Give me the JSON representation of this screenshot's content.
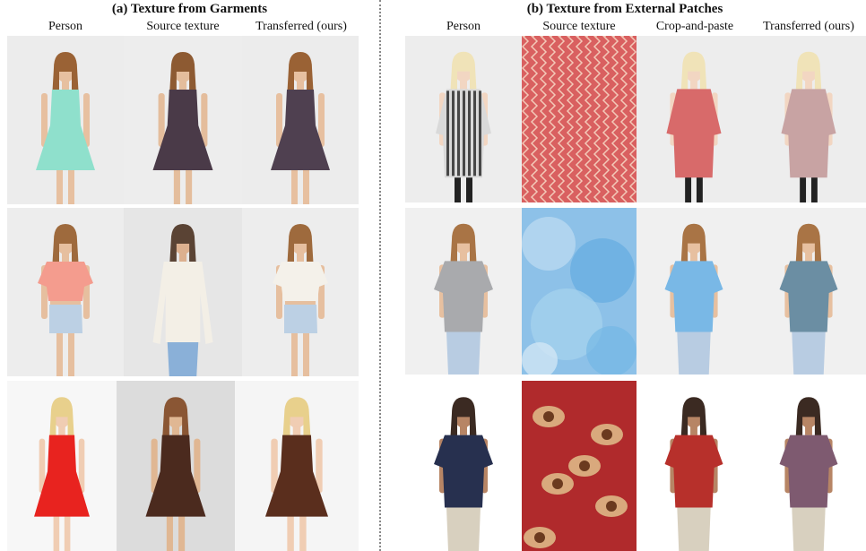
{
  "panel_a": {
    "title": "(a) Texture from Garments",
    "columns": [
      "Person",
      "Source texture",
      "Transferred (ours)"
    ]
  },
  "panel_b": {
    "title": "(b) Texture from External Patches",
    "columns": [
      "Person",
      "Source texture",
      "Crop-and-paste",
      "Transferred (ours)"
    ]
  },
  "tiles": [
    {
      "row": "a1",
      "col": "person",
      "garment": "#8fe0cc",
      "bg": "#ececec",
      "skin": "#e7c0a0",
      "hair": "#9a6235",
      "type": "dress"
    },
    {
      "row": "a1",
      "col": "source",
      "garment": "#4a3a48",
      "bg": "#ededed",
      "skin": "#e4bd9c",
      "hair": "#8d5a32",
      "type": "dress-short"
    },
    {
      "row": "a1",
      "col": "ours",
      "garment": "#4f4050",
      "bg": "#ececec",
      "skin": "#e7c0a0",
      "hair": "#9a6235",
      "type": "dress"
    },
    {
      "row": "a2",
      "col": "person",
      "garment": "#f49c8e",
      "bg": "#ededed",
      "skin": "#e6bf9f",
      "hair": "#9e6a3d",
      "type": "crop",
      "pants": "#bcd0e4"
    },
    {
      "row": "a2",
      "col": "source",
      "garment": "#f3efe6",
      "bg": "#e6e6e6",
      "skin": "#dcb08f",
      "hair": "#5a4334",
      "type": "longsleeve",
      "pants": "#8ab0d8"
    },
    {
      "row": "a2",
      "col": "ours",
      "garment": "#f4f1ea",
      "bg": "#ededed",
      "skin": "#e6bf9f",
      "hair": "#9e6a3d",
      "type": "crop",
      "pants": "#bcd0e4"
    },
    {
      "row": "a3",
      "col": "person",
      "garment": "#e8231f",
      "bg": "#f7f7f7",
      "skin": "#f0cdb3",
      "hair": "#e8d08c",
      "type": "dress"
    },
    {
      "row": "a3",
      "col": "source",
      "garment": "#4b2a1e",
      "bg": "#dcdcdc",
      "skin": "#e0b793",
      "hair": "#8a5634",
      "type": "tank-dress"
    },
    {
      "row": "a3",
      "col": "ours",
      "garment": "#5a2e1d",
      "bg": "#f5f5f5",
      "skin": "#f0cdb3",
      "hair": "#e8d08c",
      "type": "dress"
    },
    {
      "row": "b1",
      "col": "person",
      "garment": "#d9d9d9",
      "bg": "#ededed",
      "skin": "#f2d6c2",
      "hair": "#f0e3b8",
      "type": "shirtdress",
      "stripes": "#222"
    },
    {
      "row": "b1",
      "col": "source",
      "garment": "#d96060",
      "type": "zigzag"
    },
    {
      "row": "b1",
      "col": "crop",
      "garment": "#d86a6a",
      "bg": "#ededed",
      "skin": "#f2d6c2",
      "hair": "#f0e3b8",
      "type": "shirtdress"
    },
    {
      "row": "b1",
      "col": "ours",
      "garment": "#c8a3a3",
      "bg": "#ededed",
      "skin": "#f2d6c2",
      "hair": "#f0e3b8",
      "type": "shirtdress"
    },
    {
      "row": "b2",
      "col": "person",
      "garment": "#a9aaad",
      "bg": "#f0f0f0",
      "skin": "#e7c0a0",
      "hair": "#a97445",
      "type": "tee",
      "pants": "#b8cce2"
    },
    {
      "row": "b2",
      "col": "source",
      "garment": "#8dc1e8",
      "type": "watercolor"
    },
    {
      "row": "b2",
      "col": "crop",
      "garment": "#79b8e6",
      "bg": "#f0f0f0",
      "skin": "#e7c0a0",
      "hair": "#a97445",
      "type": "tee",
      "pants": "#b8cce2"
    },
    {
      "row": "b2",
      "col": "ours",
      "garment": "#6b8ea3",
      "bg": "#f0f0f0",
      "skin": "#e7c0a0",
      "hair": "#a97445",
      "type": "tee",
      "pants": "#b8cce2"
    },
    {
      "row": "b3",
      "col": "person",
      "garment": "#27304f",
      "bg": "#ffffff",
      "skin": "#b78565",
      "hair": "#3b2a22",
      "type": "tee-man",
      "pants": "#d8d0bf"
    },
    {
      "row": "b3",
      "col": "source",
      "garment": "#b02a2c",
      "type": "paisley"
    },
    {
      "row": "b3",
      "col": "crop",
      "garment": "#b7302b",
      "bg": "#ffffff",
      "skin": "#b78565",
      "hair": "#3b2a22",
      "type": "tee-man",
      "pants": "#d8d0bf"
    },
    {
      "row": "b3",
      "col": "ours",
      "garment": "#7e5a70",
      "bg": "#ffffff",
      "skin": "#b78565",
      "hair": "#3b2a22",
      "type": "tee-man",
      "pants": "#d8d0bf"
    }
  ]
}
